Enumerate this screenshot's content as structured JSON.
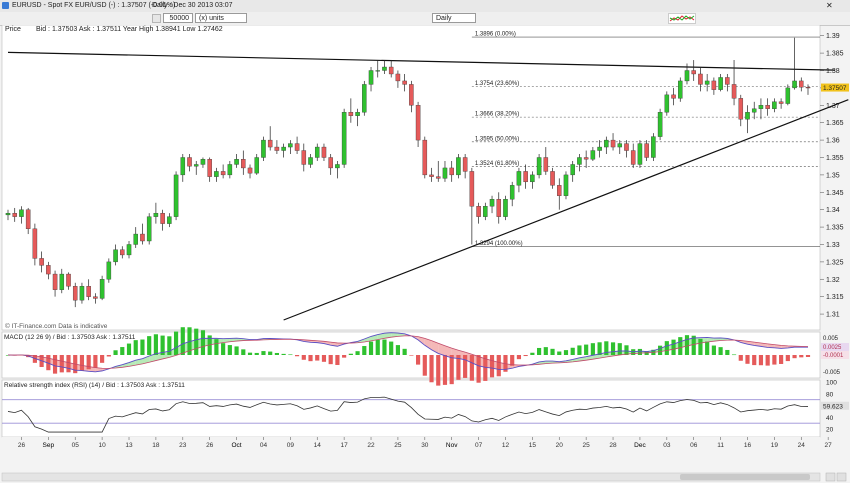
{
  "window": {
    "instrument": "EURUSD - Spot FX EUR/USD (-) : 1.37507 (-0.01%)",
    "period_info": "Daily : Dec 30 2013 03:07"
  },
  "toolbar": {
    "units_value": "50000",
    "units_type": "(x) units",
    "interval": "Daily"
  },
  "colors": {
    "up_candle": "#2fc12f",
    "down_candle": "#e55a5a",
    "background": "#ffffff",
    "frame": "#f3f3f3",
    "rsi_band": "#9a8fd6",
    "price_label": "#f1c21b"
  },
  "chart_data": [
    {
      "type": "candlestick",
      "panel": "Price",
      "header": "Price",
      "quote": "Bid : 1.37503 Ask : 1.37511 Year High 1.38941 Low 1.27462",
      "watermark": "© IT-Finance.com Data is indicative",
      "last_price_label": "1.37507",
      "y_ticks": [
        1.31,
        1.315,
        1.32,
        1.325,
        1.33,
        1.335,
        1.34,
        1.345,
        1.35,
        1.355,
        1.36,
        1.365,
        1.37,
        1.375,
        1.38,
        1.385,
        1.39
      ],
      "ylim": [
        1.306,
        1.3925
      ],
      "x_labels": [
        {
          "i": 2,
          "label": "26"
        },
        {
          "i": 6,
          "label": "Sep"
        },
        {
          "i": 10,
          "label": "05"
        },
        {
          "i": 14,
          "label": "10"
        },
        {
          "i": 18,
          "label": "13"
        },
        {
          "i": 22,
          "label": "18"
        },
        {
          "i": 26,
          "label": "23"
        },
        {
          "i": 30,
          "label": "26"
        },
        {
          "i": 34,
          "label": "Oct"
        },
        {
          "i": 38,
          "label": "04"
        },
        {
          "i": 42,
          "label": "09"
        },
        {
          "i": 46,
          "label": "14"
        },
        {
          "i": 50,
          "label": "17"
        },
        {
          "i": 54,
          "label": "22"
        },
        {
          "i": 58,
          "label": "25"
        },
        {
          "i": 62,
          "label": "30"
        },
        {
          "i": 66,
          "label": "Nov"
        },
        {
          "i": 70,
          "label": "07"
        },
        {
          "i": 74,
          "label": "12"
        },
        {
          "i": 78,
          "label": "15"
        },
        {
          "i": 82,
          "label": "20"
        },
        {
          "i": 86,
          "label": "25"
        },
        {
          "i": 90,
          "label": "28"
        },
        {
          "i": 94,
          "label": "Dec"
        },
        {
          "i": 98,
          "label": "03"
        },
        {
          "i": 102,
          "label": "06"
        },
        {
          "i": 106,
          "label": "11"
        },
        {
          "i": 110,
          "label": "16"
        },
        {
          "i": 114,
          "label": "19"
        },
        {
          "i": 118,
          "label": "24"
        },
        {
          "i": 122,
          "label": "27"
        }
      ],
      "fib_levels": [
        {
          "label": "1.3896 (0.00%)",
          "value": 1.3896
        },
        {
          "label": "1.3754 (23.60%)",
          "value": 1.3754
        },
        {
          "label": "1.3666 (38.20%)",
          "value": 1.3666
        },
        {
          "label": "1.3595 (50.00%)",
          "value": 1.3595
        },
        {
          "label": "1.3524 (61.80%)",
          "value": 1.3524
        },
        {
          "label": "1.3294 (100.00%)",
          "value": 1.3294
        }
      ],
      "trendlines": [
        {
          "name": "descending resistance",
          "from": {
            "i": 0,
            "value": 1.3852
          },
          "to": {
            "i": 123,
            "value": 1.3801
          }
        },
        {
          "name": "ascending support",
          "from": {
            "i": 41,
            "value": 1.3083
          },
          "to": {
            "i": 125,
            "value": 1.3716
          }
        }
      ],
      "ohlc": [
        [
          1.3385,
          1.34,
          1.337,
          1.339
        ],
        [
          1.339,
          1.3405,
          1.3365,
          1.338
        ],
        [
          1.338,
          1.341,
          1.336,
          1.34
        ],
        [
          1.34,
          1.3405,
          1.333,
          1.3345
        ],
        [
          1.3345,
          1.336,
          1.324,
          1.326
        ],
        [
          1.326,
          1.328,
          1.322,
          1.324
        ],
        [
          1.324,
          1.325,
          1.32,
          1.3215
        ],
        [
          1.3215,
          1.3225,
          1.315,
          1.317
        ],
        [
          1.317,
          1.323,
          1.316,
          1.3215
        ],
        [
          1.3215,
          1.322,
          1.317,
          1.318
        ],
        [
          1.318,
          1.319,
          1.312,
          1.314
        ],
        [
          1.314,
          1.319,
          1.313,
          1.318
        ],
        [
          1.318,
          1.32,
          1.314,
          1.315
        ],
        [
          1.315,
          1.316,
          1.313,
          1.3145
        ],
        [
          1.3145,
          1.321,
          1.314,
          1.32
        ],
        [
          1.32,
          1.326,
          1.319,
          1.325
        ],
        [
          1.325,
          1.33,
          1.324,
          1.3285
        ],
        [
          1.3285,
          1.3295,
          1.326,
          1.327
        ],
        [
          1.327,
          1.331,
          1.326,
          1.33
        ],
        [
          1.33,
          1.335,
          1.329,
          1.333
        ],
        [
          1.333,
          1.336,
          1.33,
          1.331
        ],
        [
          1.331,
          1.339,
          1.33,
          1.338
        ],
        [
          1.338,
          1.342,
          1.336,
          1.339
        ],
        [
          1.339,
          1.34,
          1.334,
          1.336
        ],
        [
          1.336,
          1.339,
          1.335,
          1.338
        ],
        [
          1.338,
          1.351,
          1.337,
          1.35
        ],
        [
          1.35,
          1.356,
          1.348,
          1.355
        ],
        [
          1.355,
          1.356,
          1.351,
          1.3525
        ],
        [
          1.3525,
          1.354,
          1.35,
          1.353
        ],
        [
          1.353,
          1.355,
          1.352,
          1.3545
        ],
        [
          1.3545,
          1.355,
          1.348,
          1.3495
        ],
        [
          1.3495,
          1.352,
          1.348,
          1.351
        ],
        [
          1.351,
          1.353,
          1.349,
          1.35
        ],
        [
          1.35,
          1.354,
          1.349,
          1.353
        ],
        [
          1.353,
          1.356,
          1.352,
          1.3545
        ],
        [
          1.3545,
          1.357,
          1.35,
          1.352
        ],
        [
          1.352,
          1.353,
          1.349,
          1.3505
        ],
        [
          1.3505,
          1.356,
          1.35,
          1.355
        ],
        [
          1.355,
          1.361,
          1.354,
          1.36
        ],
        [
          1.36,
          1.364,
          1.357,
          1.358
        ],
        [
          1.358,
          1.36,
          1.356,
          1.357
        ],
        [
          1.357,
          1.359,
          1.355,
          1.358
        ],
        [
          1.358,
          1.36,
          1.356,
          1.359
        ],
        [
          1.359,
          1.361,
          1.356,
          1.357
        ],
        [
          1.357,
          1.359,
          1.351,
          1.353
        ],
        [
          1.353,
          1.356,
          1.352,
          1.355
        ],
        [
          1.355,
          1.359,
          1.354,
          1.358
        ],
        [
          1.358,
          1.359,
          1.354,
          1.355
        ],
        [
          1.355,
          1.356,
          1.35,
          1.352
        ],
        [
          1.352,
          1.354,
          1.349,
          1.353
        ],
        [
          1.353,
          1.369,
          1.352,
          1.368
        ],
        [
          1.368,
          1.372,
          1.365,
          1.367
        ],
        [
          1.367,
          1.369,
          1.364,
          1.368
        ],
        [
          1.368,
          1.377,
          1.367,
          1.376
        ],
        [
          1.376,
          1.381,
          1.374,
          1.38
        ],
        [
          1.38,
          1.383,
          1.378,
          1.38
        ],
        [
          1.38,
          1.383,
          1.379,
          1.381
        ],
        [
          1.381,
          1.383,
          1.378,
          1.379
        ],
        [
          1.379,
          1.38,
          1.375,
          1.377
        ],
        [
          1.377,
          1.379,
          1.374,
          1.376
        ],
        [
          1.376,
          1.377,
          1.368,
          1.37
        ],
        [
          1.37,
          1.371,
          1.358,
          1.36
        ],
        [
          1.36,
          1.361,
          1.349,
          1.35
        ],
        [
          1.35,
          1.352,
          1.348,
          1.3495
        ],
        [
          1.3495,
          1.354,
          1.348,
          1.349
        ],
        [
          1.349,
          1.354,
          1.348,
          1.352
        ],
        [
          1.352,
          1.354,
          1.348,
          1.35
        ],
        [
          1.35,
          1.356,
          1.349,
          1.355
        ],
        [
          1.355,
          1.356,
          1.349,
          1.351
        ],
        [
          1.351,
          1.352,
          1.33,
          1.341
        ],
        [
          1.341,
          1.342,
          1.336,
          1.338
        ],
        [
          1.338,
          1.342,
          1.337,
          1.341
        ],
        [
          1.341,
          1.344,
          1.339,
          1.343
        ],
        [
          1.343,
          1.345,
          1.336,
          1.338
        ],
        [
          1.338,
          1.344,
          1.337,
          1.343
        ],
        [
          1.343,
          1.348,
          1.341,
          1.347
        ],
        [
          1.347,
          1.352,
          1.345,
          1.351
        ],
        [
          1.351,
          1.353,
          1.346,
          1.348
        ],
        [
          1.348,
          1.351,
          1.346,
          1.35
        ],
        [
          1.35,
          1.356,
          1.349,
          1.355
        ],
        [
          1.355,
          1.358,
          1.35,
          1.351
        ],
        [
          1.351,
          1.352,
          1.346,
          1.347
        ],
        [
          1.347,
          1.349,
          1.34,
          1.344
        ],
        [
          1.344,
          1.351,
          1.343,
          1.35
        ],
        [
          1.35,
          1.354,
          1.348,
          1.353
        ],
        [
          1.353,
          1.356,
          1.351,
          1.355
        ],
        [
          1.355,
          1.357,
          1.352,
          1.3545
        ],
        [
          1.3545,
          1.358,
          1.354,
          1.357
        ],
        [
          1.357,
          1.36,
          1.355,
          1.358
        ],
        [
          1.358,
          1.361,
          1.356,
          1.36
        ],
        [
          1.36,
          1.362,
          1.357,
          1.358
        ],
        [
          1.358,
          1.36,
          1.356,
          1.359
        ],
        [
          1.359,
          1.36,
          1.355,
          1.357
        ],
        [
          1.357,
          1.359,
          1.352,
          1.353
        ],
        [
          1.353,
          1.36,
          1.352,
          1.359
        ],
        [
          1.359,
          1.36,
          1.354,
          1.355
        ],
        [
          1.355,
          1.362,
          1.354,
          1.361
        ],
        [
          1.361,
          1.369,
          1.36,
          1.368
        ],
        [
          1.368,
          1.374,
          1.367,
          1.373
        ],
        [
          1.373,
          1.375,
          1.37,
          1.372
        ],
        [
          1.372,
          1.378,
          1.371,
          1.377
        ],
        [
          1.377,
          1.382,
          1.376,
          1.38
        ],
        [
          1.38,
          1.383,
          1.377,
          1.379
        ],
        [
          1.379,
          1.381,
          1.374,
          1.376
        ],
        [
          1.376,
          1.379,
          1.374,
          1.377
        ],
        [
          1.377,
          1.378,
          1.373,
          1.3745
        ],
        [
          1.3745,
          1.379,
          1.374,
          1.378
        ],
        [
          1.378,
          1.379,
          1.374,
          1.376
        ],
        [
          1.376,
          1.383,
          1.37,
          1.372
        ],
        [
          1.372,
          1.373,
          1.364,
          1.366
        ],
        [
          1.366,
          1.37,
          1.362,
          1.368
        ],
        [
          1.368,
          1.371,
          1.366,
          1.369
        ],
        [
          1.369,
          1.372,
          1.366,
          1.37
        ],
        [
          1.37,
          1.372,
          1.367,
          1.369
        ],
        [
          1.369,
          1.372,
          1.368,
          1.371
        ],
        [
          1.371,
          1.372,
          1.369,
          1.3705
        ],
        [
          1.3705,
          1.376,
          1.37,
          1.375
        ],
        [
          1.375,
          1.3894,
          1.3745,
          1.377
        ],
        [
          1.377,
          1.378,
          1.374,
          1.3752
        ],
        [
          1.3752,
          1.376,
          1.373,
          1.3751
        ]
      ]
    },
    {
      "type": "line",
      "panel": "MACD",
      "header": "MACD (12 26 9) / Bid : 1.37503 Ask : 1.37511",
      "y_ticks_labels": [
        "0.005",
        "0.0025",
        "-0.0001",
        "-0.005"
      ],
      "ylim": [
        -0.0075,
        0.0075
      ],
      "note": "MACD line, signal line and histogram derived from closes"
    },
    {
      "type": "line",
      "panel": "RSI",
      "header": "Relative strength index (RSI) (14) / Bid : 1.37503 Ask : 1.37511",
      "y_ticks": [
        20,
        40,
        60,
        80,
        100
      ],
      "ylim": [
        10,
        100
      ],
      "bands": [
        30,
        70
      ],
      "last_value_label": "59.623"
    }
  ]
}
